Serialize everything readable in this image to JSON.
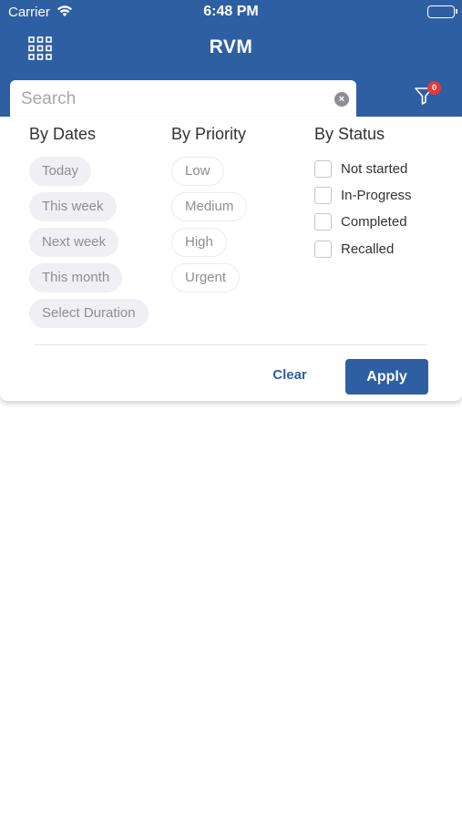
{
  "status_bar": {
    "carrier": "Carrier",
    "time": "6:48 PM"
  },
  "nav": {
    "title": "RVM",
    "menu_icon": "grid-icon"
  },
  "search": {
    "placeholder": "Search",
    "value": "",
    "clear_icon": "clear-circle-icon"
  },
  "filter": {
    "icon": "filter-funnel-icon",
    "badge_count": "0"
  },
  "filters_panel": {
    "dates": {
      "heading": "By Dates",
      "options": [
        "Today",
        "This week",
        "Next week",
        "This month",
        "Select Duration"
      ]
    },
    "priority": {
      "heading": "By Priority",
      "options": [
        "Low",
        "Medium",
        "High",
        "Urgent"
      ]
    },
    "status": {
      "heading": "By Status",
      "options": [
        "Not started",
        "In-Progress",
        "Completed",
        "Recalled"
      ]
    },
    "clear_label": "Clear",
    "apply_label": "Apply"
  },
  "colors": {
    "brand": "#2e5fa3",
    "badge": "#e53935",
    "chip_fill": "#efeff4",
    "chip_text": "#8e8e93"
  }
}
